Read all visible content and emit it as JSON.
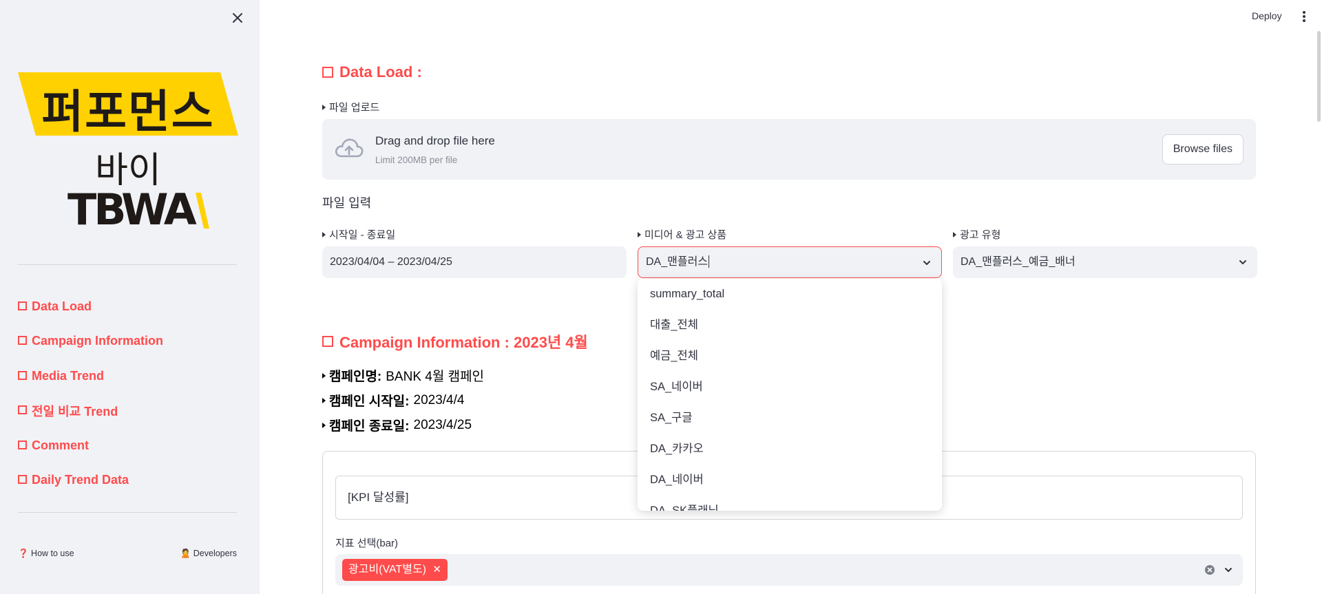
{
  "sidebar": {
    "logo": {
      "line1": "퍼포먼스",
      "line2": "바이",
      "line3": "TBWA",
      "banner_color": "#ffd100"
    },
    "nav_items": [
      {
        "label": "Data Load"
      },
      {
        "label": "Campaign Information"
      },
      {
        "label": "Media Trend"
      },
      {
        "label": "전일 비교 Trend"
      },
      {
        "label": "Comment"
      },
      {
        "label": "Daily Trend Data"
      }
    ],
    "footer": {
      "how_to_use": "❓ How to use",
      "developers": "🙎 Developers"
    }
  },
  "header": {
    "deploy_label": "Deploy"
  },
  "data_load": {
    "title": "Data Load :",
    "upload_label": "파일 업로드",
    "uploader": {
      "title": "Drag and drop file here",
      "subtitle": "Limit 200MB per file",
      "browse_label": "Browse files"
    },
    "input_heading": "파일 입력",
    "date_label": "시작일 - 종료일",
    "date_value": "2023/04/04 – 2023/04/25",
    "media_label": "미디어 & 광고 상품",
    "media_value": "DA_맨플러스",
    "type_label": "광고 유형",
    "type_value": "DA_맨플러스_예금_배너",
    "media_options": [
      "summary_total",
      "대출_전체",
      "예금_전체",
      "SA_네이버",
      "SA_구글",
      "DA_카카오",
      "DA_네이버",
      "DA_SK플래닛"
    ]
  },
  "campaign": {
    "title": "Campaign Information : 2023년 4월",
    "name_key": "캠페인명:",
    "name_value": "BANK 4월 캠페인",
    "start_key": "캠페인 시작일:",
    "start_value": "2023/4/4",
    "end_key": "캠페인 종료일:",
    "end_value": "2023/4/25",
    "kpi_label": "[KPI 달성률]",
    "metric_select_label": "지표 선택(bar)",
    "metric_selected_tag": "광고비(VAT별도)"
  },
  "colors": {
    "accent": "#ff4b4b",
    "sidebar_bg": "#f0f2f6",
    "text": "#31333f"
  }
}
